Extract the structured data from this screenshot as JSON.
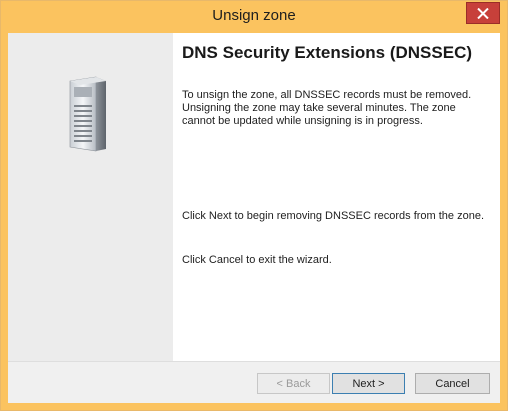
{
  "window": {
    "title": "Unsign zone",
    "close_icon": "close-icon"
  },
  "banner": {
    "icon": "server-icon"
  },
  "content": {
    "heading": "DNS Security Extensions (DNSSEC)",
    "paragraph1": "To unsign the zone, all DNSSEC records must be removed. Unsigning the zone may take several minutes. The zone cannot be updated while unsigning is in progress.",
    "paragraph2": "Click Next to begin removing DNSSEC records from the zone.",
    "paragraph3": "Click Cancel to exit the wizard."
  },
  "buttons": {
    "back": "< Back",
    "next": "Next >",
    "cancel": "Cancel"
  },
  "colors": {
    "titlebar": "#fbc35f",
    "close_button": "#c7403a",
    "banner": "#ececec"
  }
}
